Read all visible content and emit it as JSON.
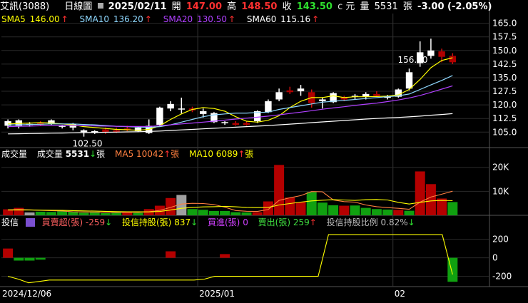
{
  "header": {
    "stock": "艾訊(3088)",
    "chart_kind": "日線圖",
    "date": "2025/02/11",
    "open_label": "開",
    "open": "147.00",
    "high_label": "高",
    "high": "148.50",
    "close_label": "收",
    "close": "143.50",
    "close_unit": "c 元",
    "vol_label": "量",
    "volume": "5531",
    "vol_unit": "張",
    "change": "-3.00 (-2.05%)"
  },
  "ma_legend": [
    {
      "label": "SMA5",
      "value": "146.00",
      "arrow": "↑",
      "color": "#ffff00"
    },
    {
      "label": "SMA10",
      "value": "136.20",
      "arrow": "↑",
      "color": "#8fd8ff"
    },
    {
      "label": "SMA20",
      "value": "130.50",
      "arrow": "↑",
      "color": "#b040ff"
    },
    {
      "label": "SMA60",
      "value": "115.16",
      "arrow": "↑",
      "color": "#ffffff"
    }
  ],
  "vol_legend": {
    "title": "成交量",
    "vol_label": "成交量",
    "vol_value": "5531",
    "vol_arrow": "↓",
    "vol_unit": "張",
    "ma5_label": "MA5",
    "ma5_value": "10042",
    "ma5_arrow": "↑",
    "ma5_unit": "張",
    "ma10_label": "MA10",
    "ma10_value": "6089",
    "ma10_arrow": "↑",
    "ma10_unit": "張"
  },
  "inst_legend": {
    "title": "投信",
    "net_label": "買賣超(張)",
    "net_value": "-259",
    "net_arrow": "↓",
    "hold_label": "投信持股(張)",
    "hold_value": "837",
    "hold_arrow": "↓",
    "buy_label": "買進(張)",
    "buy_value": "0",
    "sell_label": "賣出(張)",
    "sell_value": "259",
    "sell_arrow": "↑",
    "ratio_label": "投信持股比例",
    "ratio_value": "0.82%",
    "ratio_arrow": "↓"
  },
  "chart_data": [
    {
      "type": "candlestick",
      "title": "",
      "yticks": [
        "165.0",
        "157.5",
        "150.0",
        "142.5",
        "135.0",
        "127.5",
        "120.0",
        "112.5",
        "105.0"
      ],
      "ylim": [
        100,
        168
      ],
      "annotations": [
        {
          "text": "156.50",
          "at_index": 37
        },
        {
          "text": "102.50",
          "at_index": 7
        }
      ],
      "candles": [
        {
          "o": 108.5,
          "h": 112,
          "l": 107,
          "c": 111
        },
        {
          "o": 108.5,
          "h": 112,
          "l": 107,
          "c": 111.5
        },
        {
          "o": 109,
          "h": 110.5,
          "l": 108,
          "c": 109.5
        },
        {
          "o": 110,
          "h": 111,
          "l": 108.5,
          "c": 109
        },
        {
          "o": 109.5,
          "h": 112,
          "l": 109,
          "c": 111.5
        },
        {
          "o": 108,
          "h": 109,
          "l": 107,
          "c": 108.5
        },
        {
          "o": 107.5,
          "h": 110,
          "l": 106,
          "c": 109.5
        },
        {
          "o": 105,
          "h": 106.5,
          "l": 102.5,
          "c": 106
        },
        {
          "o": 104.5,
          "h": 106,
          "l": 104,
          "c": 105.5
        },
        {
          "o": 106.5,
          "h": 107.5,
          "l": 104,
          "c": 105
        },
        {
          "o": 106,
          "h": 107.5,
          "l": 104.5,
          "c": 105
        },
        {
          "o": 107,
          "h": 108.5,
          "l": 105.5,
          "c": 106
        },
        {
          "o": 105.5,
          "h": 108,
          "l": 105,
          "c": 107.5
        },
        {
          "o": 104.5,
          "h": 112,
          "l": 104,
          "c": 108.5
        },
        {
          "o": 109,
          "h": 119,
          "l": 108.5,
          "c": 118.5
        },
        {
          "o": 118,
          "h": 122,
          "l": 116.5,
          "c": 120.5
        },
        {
          "o": 117.5,
          "h": 124,
          "l": 115,
          "c": 118
        },
        {
          "o": 118,
          "h": 119,
          "l": 116,
          "c": 117
        },
        {
          "o": 115,
          "h": 118,
          "l": 113,
          "c": 116.5
        },
        {
          "o": 110.5,
          "h": 116,
          "l": 110,
          "c": 115.5
        },
        {
          "o": 110,
          "h": 111,
          "l": 109,
          "c": 110.5
        },
        {
          "o": 110,
          "h": 111,
          "l": 108.5,
          "c": 109
        },
        {
          "o": 110,
          "h": 111,
          "l": 108.5,
          "c": 109
        },
        {
          "o": 111,
          "h": 117,
          "l": 110,
          "c": 116.5
        },
        {
          "o": 116,
          "h": 123,
          "l": 115.5,
          "c": 122
        },
        {
          "o": 123,
          "h": 129,
          "l": 122,
          "c": 127
        },
        {
          "o": 128,
          "h": 130,
          "l": 126,
          "c": 127
        },
        {
          "o": 127.5,
          "h": 131,
          "l": 125,
          "c": 129
        },
        {
          "o": 127,
          "h": 128.5,
          "l": 118.5,
          "c": 121
        },
        {
          "o": 122,
          "h": 124,
          "l": 118,
          "c": 123
        },
        {
          "o": 121.5,
          "h": 127,
          "l": 121,
          "c": 126.5
        },
        {
          "o": 124,
          "h": 125,
          "l": 122,
          "c": 123
        },
        {
          "o": 124.5,
          "h": 126,
          "l": 123,
          "c": 125
        },
        {
          "o": 124.5,
          "h": 127,
          "l": 123,
          "c": 126
        },
        {
          "o": 126,
          "h": 127.5,
          "l": 124.5,
          "c": 125
        },
        {
          "o": 124,
          "h": 125.5,
          "l": 123,
          "c": 124.5
        },
        {
          "o": 124.5,
          "h": 129,
          "l": 124,
          "c": 128.5
        },
        {
          "o": 129,
          "h": 140,
          "l": 128,
          "c": 138
        },
        {
          "o": 143,
          "h": 155,
          "l": 141,
          "c": 149
        },
        {
          "o": 147,
          "h": 156.5,
          "l": 145.5,
          "c": 150
        },
        {
          "o": 149.5,
          "h": 151,
          "l": 143.5,
          "c": 146.5
        },
        {
          "o": 147,
          "h": 148.5,
          "l": 142.5,
          "c": 143.5
        }
      ],
      "series": [
        {
          "name": "SMA5",
          "color": "#ffff00",
          "values": [
            109.5,
            109.8,
            110,
            110.2,
            110,
            109.5,
            109,
            108,
            107.5,
            107,
            106.5,
            106.3,
            106,
            106.5,
            108.5,
            112,
            115,
            117.5,
            118.5,
            118,
            116.5,
            113.5,
            111,
            110.5,
            111.5,
            114,
            118.5,
            122,
            124,
            124,
            125,
            124,
            124.5,
            124.5,
            124.6,
            124.8,
            125.5,
            128.5,
            134,
            140.5,
            144.5,
            146
          ]
        },
        {
          "name": "SMA10",
          "color": "#8fd8ff",
          "values": [
            109,
            109,
            109.2,
            109.3,
            109.5,
            109.5,
            109.5,
            109.2,
            109,
            108.6,
            108.2,
            108,
            107.8,
            107.6,
            108,
            109,
            110.5,
            112,
            113.5,
            114.5,
            115,
            115.5,
            115.5,
            115.8,
            116,
            117.5,
            118.5,
            119.5,
            120.5,
            121.5,
            122,
            122.5,
            123,
            123.5,
            124,
            124.5,
            125,
            126,
            128.5,
            131,
            133.5,
            136.2
          ]
        },
        {
          "name": "SMA20",
          "color": "#b040ff",
          "values": [
            108,
            108.2,
            108.3,
            108.5,
            108.6,
            108.6,
            108.6,
            108.5,
            108.4,
            108.3,
            108.2,
            108.1,
            108.1,
            108.1,
            108.5,
            109,
            109.5,
            110,
            110.5,
            111,
            111.6,
            112.2,
            112.7,
            113.2,
            113.8,
            114.5,
            115.3,
            116,
            116.8,
            117.6,
            118.3,
            119,
            119.7,
            120.4,
            121,
            121.8,
            122.7,
            123.8,
            125.2,
            126.9,
            128.7,
            130.5
          ]
        },
        {
          "name": "SMA60",
          "color": "#ffffff",
          "values": [
            104,
            104.1,
            104.2,
            104.3,
            104.4,
            104.5,
            104.6,
            104.7,
            104.8,
            104.9,
            105,
            105.1,
            105.2,
            105.4,
            105.6,
            105.9,
            106.2,
            106.5,
            106.8,
            107.1,
            107.4,
            107.7,
            108,
            108.3,
            108.6,
            109,
            109.4,
            109.8,
            110.2,
            110.6,
            111,
            111.4,
            111.8,
            112.2,
            112.5,
            112.8,
            113.1,
            113.4,
            113.8,
            114.3,
            114.7,
            115.16
          ]
        }
      ]
    },
    {
      "type": "bar",
      "title": "",
      "yticks": [
        "20K",
        "10K"
      ],
      "ylim": [
        0,
        22000
      ],
      "up_color": "#b40000",
      "down_color": "#10a010",
      "flat_color": "#a0a0a0",
      "values": [
        2500,
        3100,
        1200,
        1500,
        1400,
        1700,
        1600,
        1100,
        1200,
        900,
        1100,
        1600,
        1000,
        2600,
        4000,
        7200,
        8500,
        2600,
        2300,
        1800,
        1800,
        1300,
        1200,
        1300,
        5800,
        21000,
        7400,
        5500,
        9700,
        5300,
        4200,
        4000,
        4100,
        3100,
        2600,
        2400,
        2300,
        1900,
        18300,
        13000,
        7000,
        5531
      ],
      "direction": [
        "u",
        "u",
        "f",
        "d",
        "d",
        "d",
        "d",
        "d",
        "d",
        "d",
        "d",
        "u",
        "d",
        "u",
        "u",
        "u",
        "f",
        "d",
        "d",
        "d",
        "d",
        "d",
        "d",
        "u",
        "u",
        "u",
        "u",
        "u",
        "d",
        "d",
        "d",
        "u",
        "d",
        "d",
        "d",
        "d",
        "u",
        "d",
        "u",
        "u",
        "u",
        "d"
      ],
      "series": [
        {
          "name": "MA5",
          "color": "#ff8040",
          "values": [
            2300,
            2400,
            2300,
            2100,
            1950,
            1800,
            1500,
            1400,
            1350,
            1250,
            1200,
            1300,
            1250,
            1450,
            2050,
            3300,
            4700,
            5000,
            4900,
            4480,
            3400,
            2000,
            1700,
            1600,
            2400,
            6200,
            7300,
            8200,
            9900,
            9800,
            6400,
            5700,
            5500,
            4300,
            3600,
            3200,
            2900,
            2500,
            5500,
            7600,
            8800,
            10042
          ]
        },
        {
          "name": "MA10",
          "color": "#ffff00",
          "values": [
            2200,
            2250,
            2200,
            2150,
            2100,
            2050,
            1950,
            1850,
            1750,
            1650,
            1550,
            1500,
            1450,
            1430,
            1600,
            2200,
            2900,
            3300,
            3500,
            3600,
            3750,
            3550,
            3300,
            3200,
            3300,
            4300,
            4900,
            5500,
            6000,
            6300,
            6500,
            6400,
            6200,
            6500,
            6600,
            6400,
            5400,
            4700,
            5400,
            6000,
            6200,
            6089
          ]
        }
      ]
    },
    {
      "type": "bar",
      "title": "",
      "yticks": [
        "200",
        "0",
        "-200"
      ],
      "ylim": [
        -280,
        320
      ],
      "pos_color": "#b40000",
      "neg_color": "#10a010",
      "values": [
        100,
        -30,
        -30,
        -20,
        0,
        0,
        0,
        0,
        0,
        0,
        0,
        0,
        0,
        0,
        0,
        0,
        0,
        0,
        0,
        0,
        0,
        0,
        0,
        0,
        0,
        0,
        0,
        0,
        0,
        0,
        0,
        0,
        0,
        0,
        0,
        0,
        0,
        0,
        0,
        0,
        0,
        -259
      ],
      "extra_bars": [
        {
          "index": 15,
          "value": 70
        },
        {
          "index": 20,
          "value": 40
        },
        {
          "index": 2,
          "value": 10
        }
      ],
      "series": [
        {
          "name": "投信持股(張)",
          "color": "#ffff00",
          "values": [
            -200,
            -230,
            -270,
            -255,
            -240,
            -240,
            -240,
            -240,
            -240,
            -240,
            -240,
            -240,
            -240,
            -240,
            -240,
            -240,
            -240,
            -240,
            -240,
            -230,
            -200,
            -200,
            -200,
            -200,
            -200,
            -200,
            -200,
            -200,
            -200,
            -200,
            -200,
            250,
            250,
            250,
            250,
            250,
            250,
            250,
            250,
            250,
            250,
            250,
            250,
            -180
          ]
        }
      ]
    }
  ],
  "x_axis": {
    "labels": [
      {
        "text": "2024/12/06",
        "index": 0
      },
      {
        "text": "2025/01",
        "index": 18
      },
      {
        "text": "02",
        "index": 36
      }
    ]
  }
}
